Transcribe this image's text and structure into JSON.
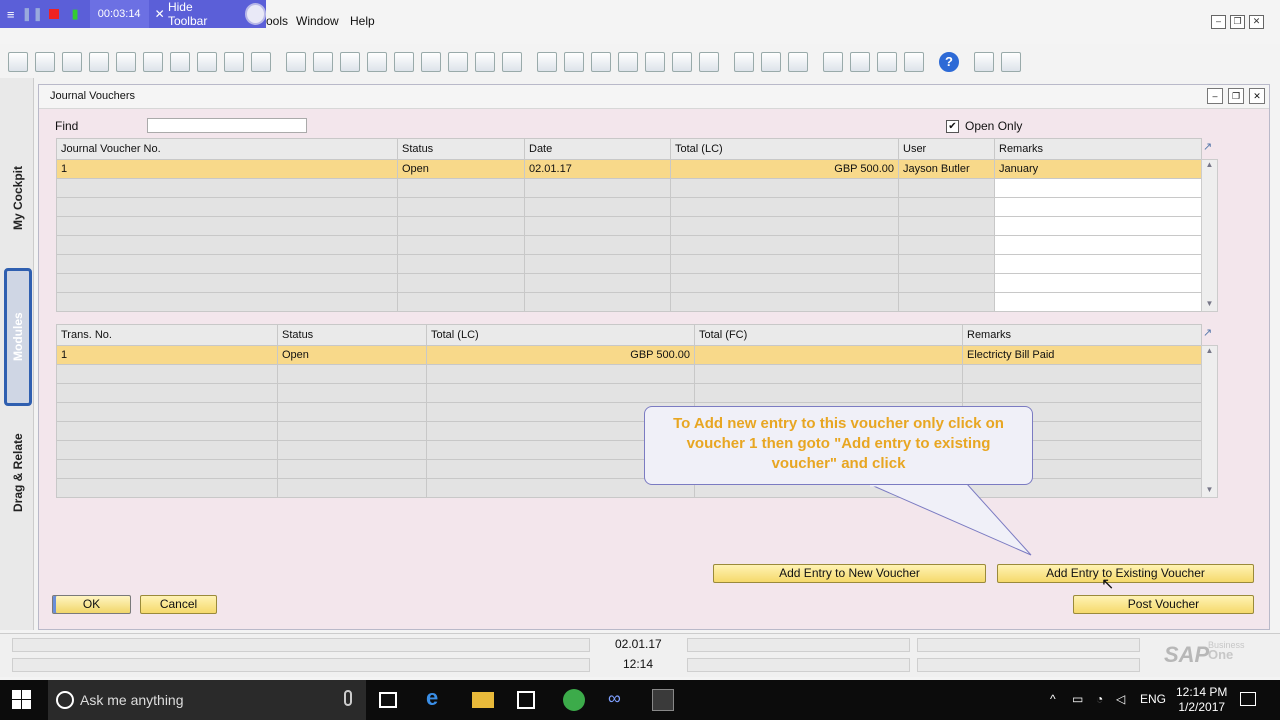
{
  "recorder": {
    "timer": "00:03:14",
    "hide_label": "Hide Toolbar"
  },
  "menu": {
    "items": [
      "ools",
      "Window",
      "Help"
    ]
  },
  "window": {
    "title": "Journal Vouchers",
    "find_label": "Find",
    "find_value": "",
    "open_only_label": "Open Only",
    "open_only_checked": true
  },
  "vouchers": {
    "columns": [
      "Journal Voucher No.",
      "Status",
      "Date",
      "Total (LC)",
      "User",
      "Remarks"
    ],
    "rows": [
      [
        "1",
        "Open",
        "02.01.17",
        "GBP 500.00",
        "Jayson Butler",
        "January"
      ]
    ]
  },
  "transactions": {
    "columns": [
      "Trans. No.",
      "Status",
      "Total (LC)",
      "Total (FC)",
      "Remarks"
    ],
    "rows": [
      [
        "1",
        "Open",
        "GBP 500.00",
        "",
        "Electricty Bill Paid"
      ]
    ]
  },
  "callout": {
    "text": "To Add new entry to this voucher only click on voucher 1 then goto \"Add entry to existing voucher\" and click"
  },
  "buttons": {
    "add_new": "Add Entry to New Voucher",
    "add_existing": "Add Entry to Existing Voucher",
    "ok": "OK",
    "cancel": "Cancel",
    "post": "Post Voucher"
  },
  "sidebar": {
    "tabs": [
      "My Cockpit",
      "Modules",
      "Drag & Relate"
    ]
  },
  "status": {
    "date": "02.01.17",
    "time": "12:14",
    "brand": "SAP",
    "brand_sub1": "Business",
    "brand_sub2": "One"
  },
  "taskbar": {
    "search_placeholder": "Ask me anything",
    "lang": "ENG",
    "clock_time": "12:14 PM",
    "clock_date": "1/2/2017"
  },
  "colors": {
    "selected_row": "#f8d98a",
    "window_bg": "#f3e6ec",
    "callout_text": "#e8a622",
    "recorder": "#5b5fd8"
  }
}
